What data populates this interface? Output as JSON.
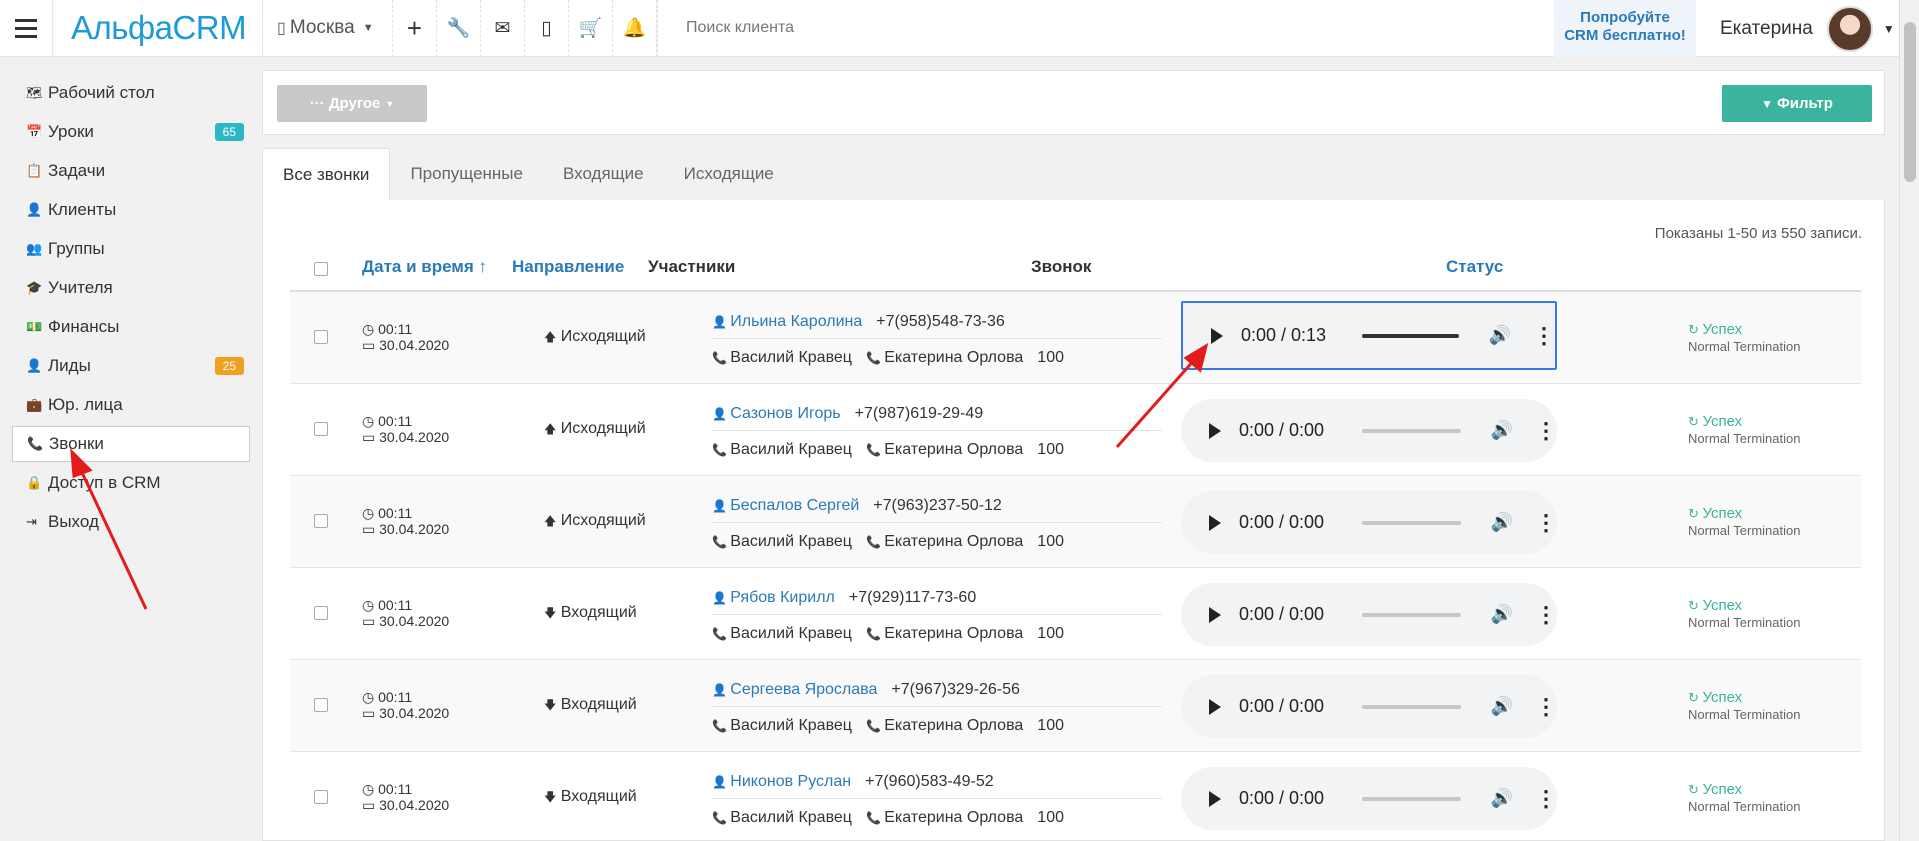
{
  "header": {
    "logo": "АльфаCRM",
    "city": "Москва",
    "search_placeholder": "Поиск клиента",
    "promo_line1": "Попробуйте",
    "promo_line2": "CRM бесплатно!",
    "user_name": "Екатерина",
    "icons": [
      "plus-icon",
      "wrench-icon",
      "envelope-icon",
      "mobile-icon",
      "cart-icon",
      "bell-icon"
    ]
  },
  "sidebar": {
    "items": [
      {
        "label": "Рабочий стол",
        "icon": "map-icon"
      },
      {
        "label": "Уроки",
        "icon": "calendar-icon",
        "badge": "65",
        "badge_color": "#2bb8c4"
      },
      {
        "label": "Задачи",
        "icon": "clipboard-icon"
      },
      {
        "label": "Клиенты",
        "icon": "user-icon"
      },
      {
        "label": "Группы",
        "icon": "users-icon"
      },
      {
        "label": "Учителя",
        "icon": "graduation-cap-icon"
      },
      {
        "label": "Финансы",
        "icon": "money-icon"
      },
      {
        "label": "Лиды",
        "icon": "user-plus-icon",
        "badge": "25",
        "badge_color": "#f0a020"
      },
      {
        "label": "Юр. лица",
        "icon": "briefcase-icon"
      },
      {
        "label": "Звонки",
        "icon": "phone-icon",
        "active": true
      },
      {
        "label": "Доступ в CRM",
        "icon": "lock-icon"
      },
      {
        "label": "Выход",
        "icon": "sign-out-icon"
      }
    ]
  },
  "toolbar": {
    "other_label": "··· Другое",
    "filter_label": "Фильтр"
  },
  "tabs": [
    "Все звонки",
    "Пропущенные",
    "Входящие",
    "Исходящие"
  ],
  "table": {
    "summary": "Показаны 1-50 из 550 записи.",
    "headers": {
      "datetime": "Дата и время ↑",
      "direction": "Направление",
      "participants": "Участники",
      "call": "Звонок",
      "status": "Статус"
    },
    "rows": [
      {
        "time": "00:11",
        "date": "30.04.2020",
        "direction": "Исходящий",
        "client": "Ильина Каролина",
        "phone": "+7(958)548-73-36",
        "agent1": "Василий Кравец",
        "agent2": "Екатерина Орлова",
        "ext": "100",
        "player_time": "0:00 / 0:13",
        "status": "Успех",
        "status_detail": "Normal Termination"
      },
      {
        "time": "00:11",
        "date": "30.04.2020",
        "direction": "Исходящий",
        "client": "Сазонов Игорь",
        "phone": "+7(987)619-29-49",
        "agent1": "Василий Кравец",
        "agent2": "Екатерина Орлова",
        "ext": "100",
        "player_time": "0:00 / 0:00",
        "status": "Успех",
        "status_detail": "Normal Termination"
      },
      {
        "time": "00:11",
        "date": "30.04.2020",
        "direction": "Исходящий",
        "client": "Беспалов Сергей",
        "phone": "+7(963)237-50-12",
        "agent1": "Василий Кравец",
        "agent2": "Екатерина Орлова",
        "ext": "100",
        "player_time": "0:00 / 0:00",
        "status": "Успех",
        "status_detail": "Normal Termination"
      },
      {
        "time": "00:11",
        "date": "30.04.2020",
        "direction": "Входящий",
        "client": "Рябов Кирилл",
        "phone": "+7(929)117-73-60",
        "agent1": "Василий Кравец",
        "agent2": "Екатерина Орлова",
        "ext": "100",
        "player_time": "0:00 / 0:00",
        "status": "Успех",
        "status_detail": "Normal Termination"
      },
      {
        "time": "00:11",
        "date": "30.04.2020",
        "direction": "Входящий",
        "client": "Сергеева Ярослава",
        "phone": "+7(967)329-26-56",
        "agent1": "Василий Кравец",
        "agent2": "Екатерина Орлова",
        "ext": "100",
        "player_time": "0:00 / 0:00",
        "status": "Успех",
        "status_detail": "Normal Termination"
      },
      {
        "time": "00:11",
        "date": "30.04.2020",
        "direction": "Входящий",
        "client": "Никонов Руслан",
        "phone": "+7(960)583-49-52",
        "agent1": "Василий Кравец",
        "agent2": "Екатерина Орлова",
        "ext": "100",
        "player_time": "0:00 / 0:00",
        "status": "Успех",
        "status_detail": "Normal Termination"
      }
    ]
  }
}
